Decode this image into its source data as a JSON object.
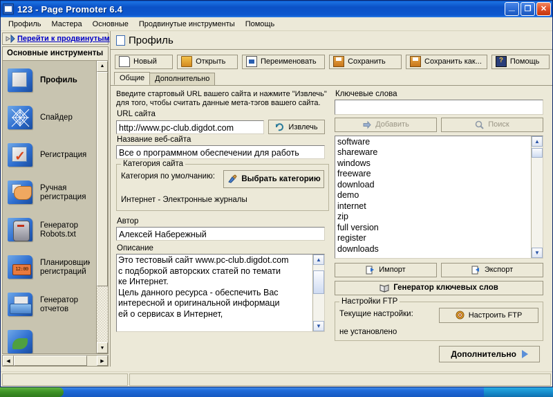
{
  "window": {
    "title": "123 - Page Promoter 6.4",
    "icon": "app-icon",
    "buttons": {
      "minimize": "_",
      "restore": "❐",
      "close": "✕"
    }
  },
  "menubar": {
    "items": [
      {
        "label": "Профиль"
      },
      {
        "label": "Мастера"
      },
      {
        "label": "Основные"
      },
      {
        "label": "Продвинутые инструменты"
      },
      {
        "label": "Помощь"
      }
    ]
  },
  "sidebar": {
    "advanced_link": "Перейти к продвинутым",
    "header": "Основные инструменты",
    "items": [
      {
        "label": "Профиль",
        "icon": "profile-page-icon",
        "selected": true
      },
      {
        "label": "Спайдер",
        "icon": "spider-web-icon",
        "selected": false
      },
      {
        "label": "Регистрация",
        "icon": "registration-check-icon",
        "selected": false
      },
      {
        "label": "Ручная регистрация",
        "icon": "hand-icon",
        "selected": false
      },
      {
        "label": "Генератор Robots.txt",
        "icon": "robot-icon",
        "selected": false
      },
      {
        "label": "Планировщик регистраций",
        "icon": "scheduler-clock-icon",
        "selected": false
      },
      {
        "label": "Генератор отчетов",
        "icon": "report-printer-icon",
        "selected": false
      }
    ]
  },
  "page": {
    "icon": "page-icon",
    "title": "Профиль"
  },
  "toolbar": {
    "buttons": [
      {
        "label": "Новый",
        "icon": "new-page-icon"
      },
      {
        "label": "Открыть",
        "icon": "open-folder-icon"
      },
      {
        "label": "Переименовать",
        "icon": "rename-icon"
      },
      {
        "label": "Сохранить",
        "icon": "save-disk-icon"
      },
      {
        "label": "Сохранить как...",
        "icon": "save-as-disk-icon"
      },
      {
        "label": "Помощь",
        "icon": "help-question-icon"
      }
    ]
  },
  "tabs": [
    {
      "label": "Общие",
      "active": true
    },
    {
      "label": "Дополнительно",
      "active": false
    }
  ],
  "left_column": {
    "hint": "Введите стартовый URL вашего сайта и нажмите \"Извлечь\" для того, чтобы считать данные мета-тэгов вашего сайта.",
    "url_label": "URL сайта",
    "url_value": "http://www.pc-club.digdot.com",
    "extract_button": {
      "label": "Извлечь",
      "icon": "refresh-icon"
    },
    "site_name_label": "Название веб-сайта",
    "site_name_value": "Все о программном обеспечении для работь",
    "category_group": {
      "legend": "Категория сайта",
      "default_label": "Категория по умолчанию:",
      "choose_button": {
        "label": "Выбрать категорию",
        "icon": "category-brush-icon"
      },
      "current_value": "Интернет - Электронные журналы"
    },
    "author_label": "Автор",
    "author_value": "Алексей Набережный",
    "description_label": "Описание",
    "description_value": "Это тестовый сайт www.pc-club.digdot.com\nс подборкой авторских статей по темати\nке Интернет.\nЦель данного ресурса - обеспечить Вас\nинтересной и оригинальной информаци\nей о сервисах в Интернет,"
  },
  "right_column": {
    "keywords_label": "Ключевые слова",
    "keyword_input_value": "",
    "add_button": {
      "label": "Добавить",
      "icon": "add-arrow-icon",
      "disabled": true
    },
    "search_button": {
      "label": "Поиск",
      "icon": "search-magnifier-icon",
      "disabled": true
    },
    "keywords": [
      "software",
      "shareware",
      "windows",
      "freeware",
      "download",
      "demo",
      "internet",
      "zip",
      "full version",
      "register",
      "downloads"
    ],
    "import_button": {
      "label": "Импорт",
      "icon": "import-icon"
    },
    "export_button": {
      "label": "Экспорт",
      "icon": "export-icon"
    },
    "generator_button": {
      "label": "Генератор ключевых слов",
      "icon": "book-icon"
    },
    "ftp_group": {
      "legend": "Настройки FTP",
      "current_label": "Текущие настройки:",
      "configure_button": {
        "label": "Настроить FTP",
        "icon": "ftp-target-icon"
      },
      "current_value": "не установлено"
    }
  },
  "footer": {
    "advanced_button": {
      "label": "Дополнительно",
      "icon": "arrow-right-icon"
    }
  },
  "statusbar": {
    "pane_left": "",
    "pane_right": ""
  },
  "taskbar": {
    "start_label": ""
  },
  "colors": {
    "window_face": "#ece9d8",
    "title_blue": "#0b51c6",
    "link_blue": "#0000c8",
    "sidebar_list": "#c8c4b0",
    "border": "#9a9580"
  }
}
